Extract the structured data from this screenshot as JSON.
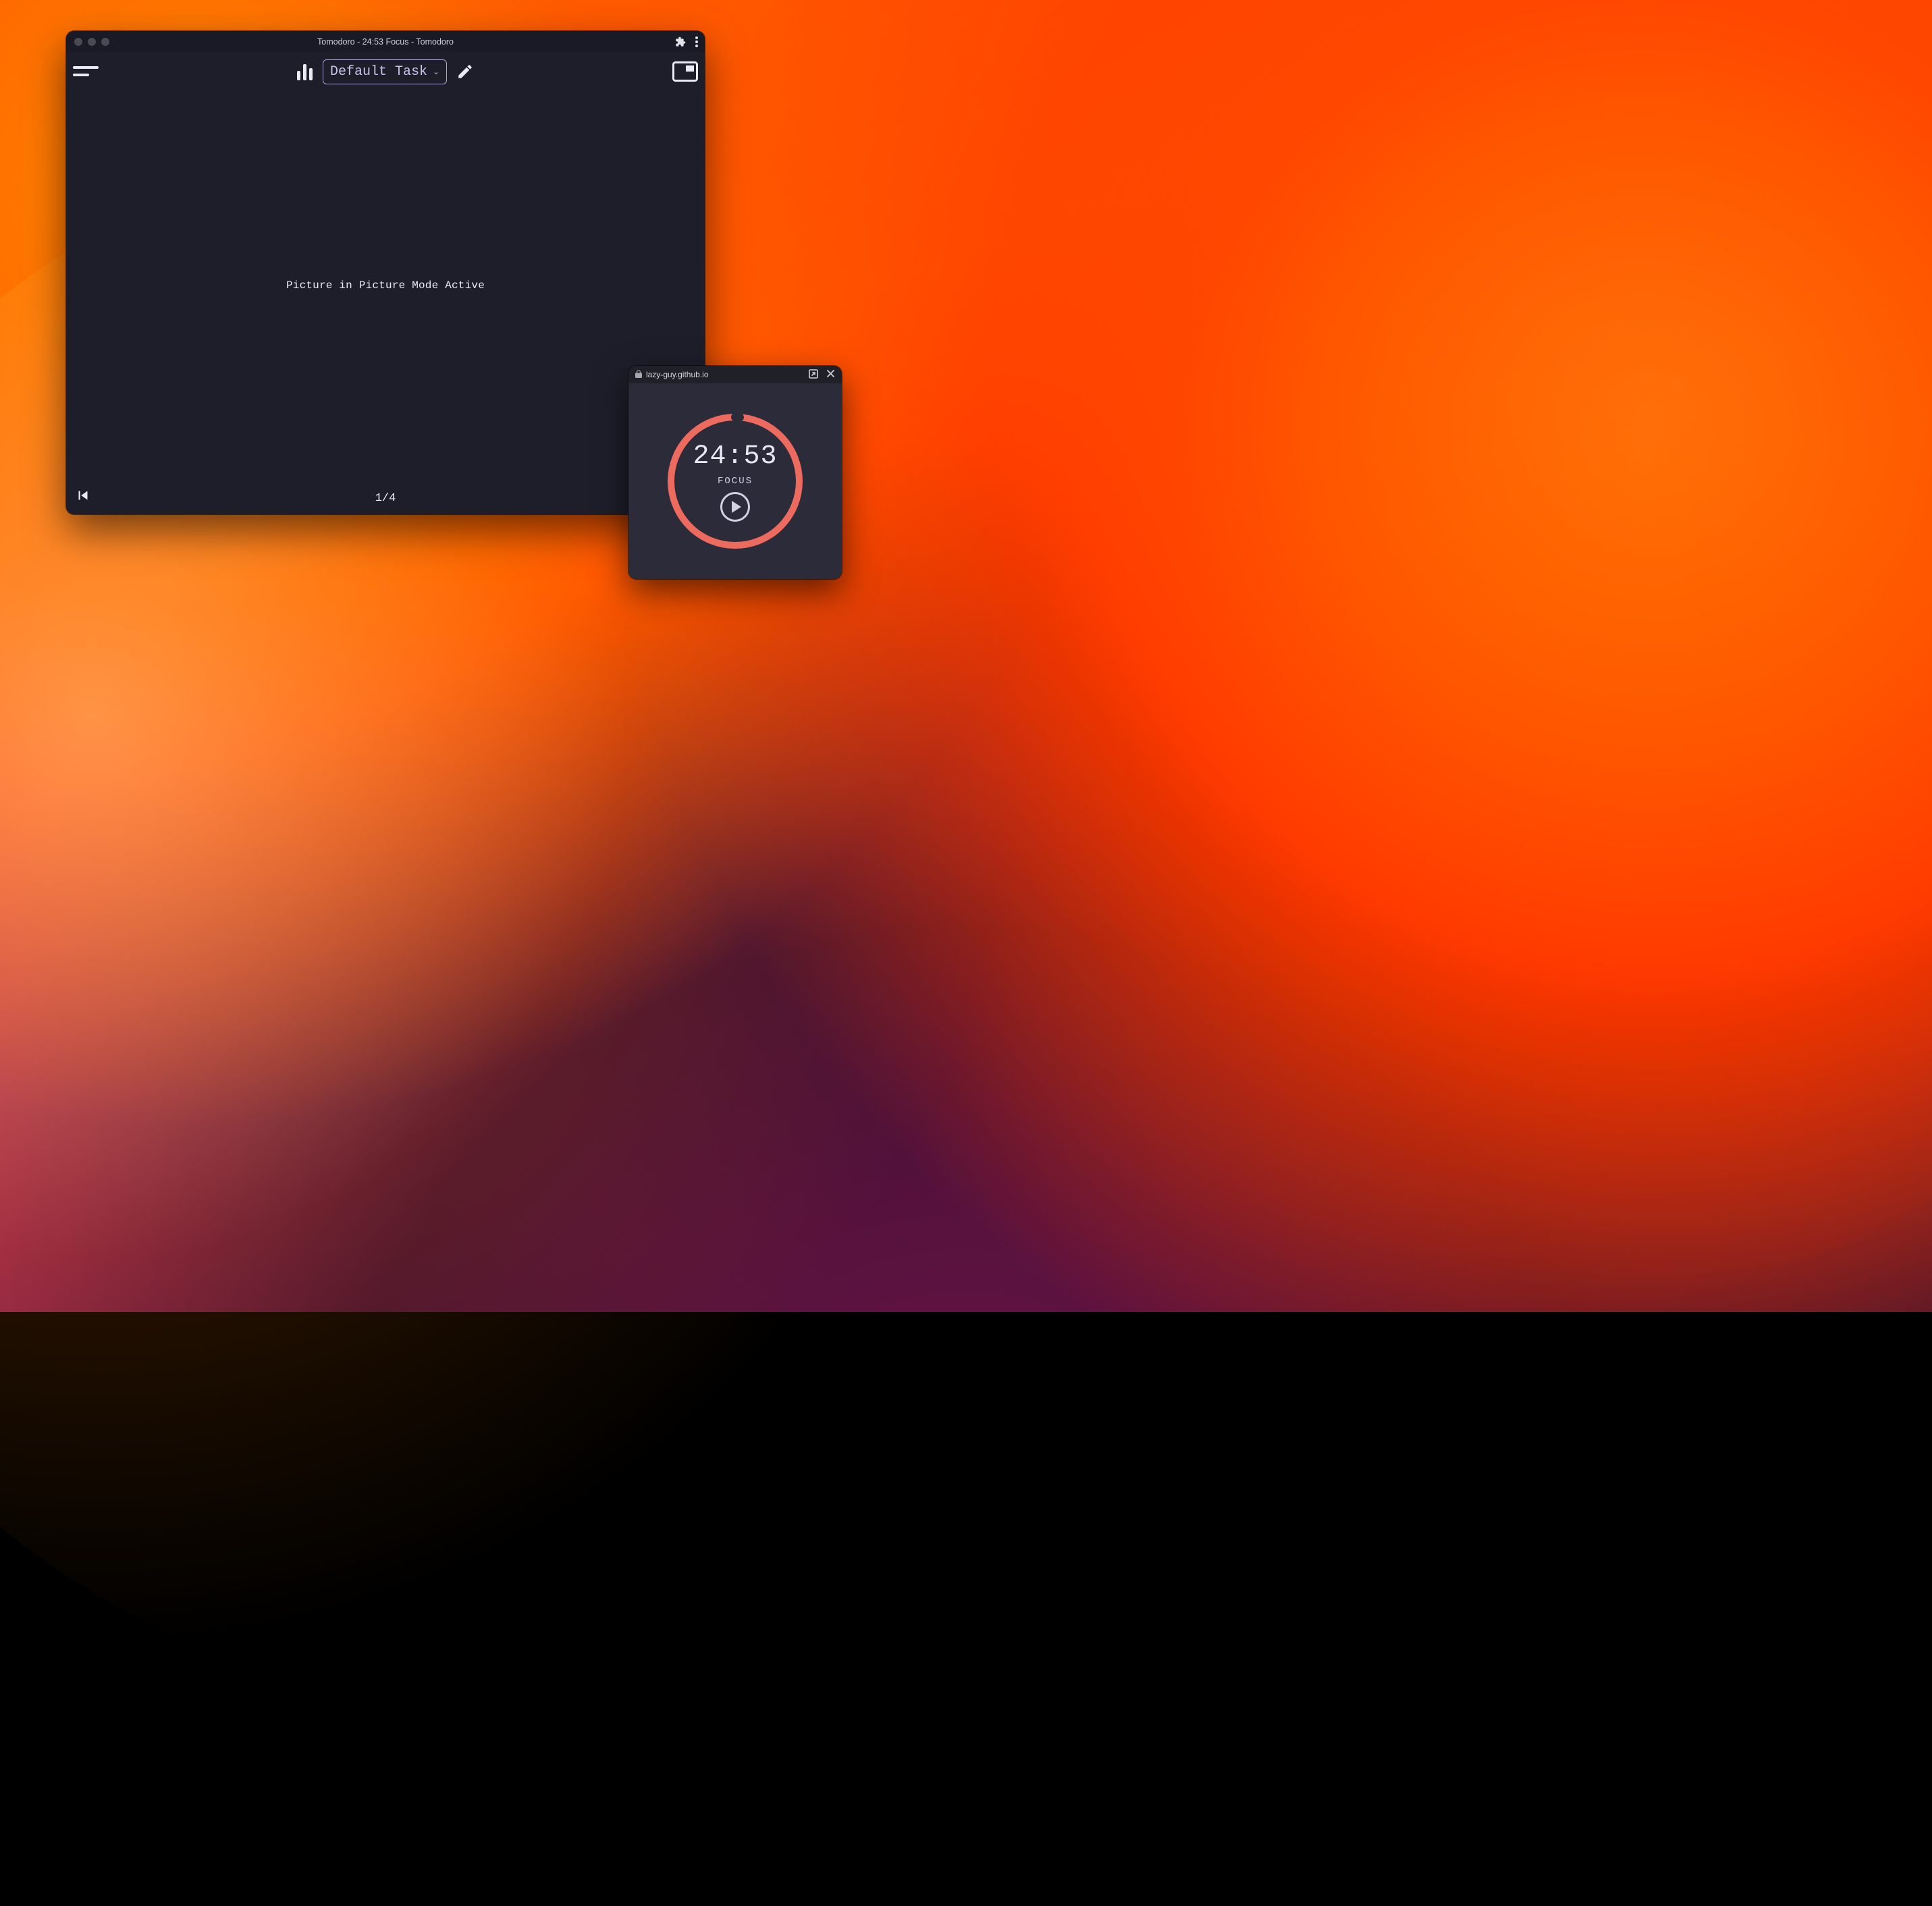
{
  "window": {
    "title": "Tomodoro - 24:53 Focus - Tomodoro"
  },
  "toolbar": {
    "task_label": "Default Task"
  },
  "content": {
    "message": "Picture in Picture Mode Active"
  },
  "footer": {
    "counter": "1/4"
  },
  "pip": {
    "domain": "lazy-guy.github.io",
    "time": "24:53",
    "mode": "FOCUS",
    "ring_progress_deg": 2
  },
  "colors": {
    "window_bg": "#1e1e2b",
    "pip_bg": "#2b2b3a",
    "ring": "#ec6a5e",
    "text": "#e9e7f2"
  }
}
